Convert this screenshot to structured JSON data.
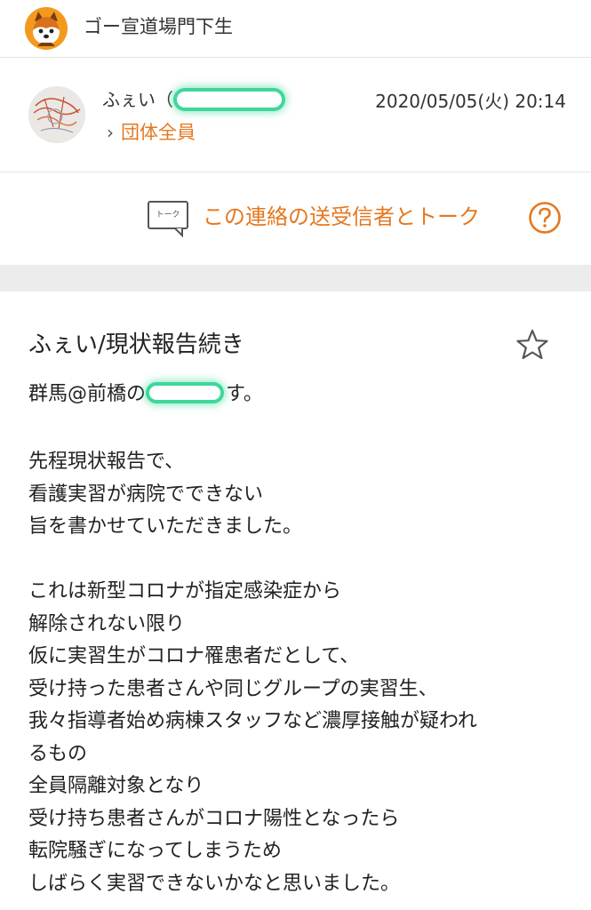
{
  "header": {
    "group_name": "ゴー宣道場門下生",
    "group_avatar_icon": "shiba-dog-icon"
  },
  "message_meta": {
    "sender_name": "ふぇい（",
    "timestamp": "2020/05/05(火) 20:14",
    "recipient_chevron": "›",
    "recipient": "団体全員"
  },
  "talk": {
    "icon_text": "トーク",
    "label": "この連絡の送受信者とトーク"
  },
  "message": {
    "subject": "ふぇい/現状報告続き",
    "greeting_prefix": "群馬@前橋の",
    "greeting_suffix": "す。",
    "paragraph1": [
      "先程現状報告で、",
      "看護実習が病院でできない",
      "旨を書かせていただきました。"
    ],
    "paragraph2": [
      "これは新型コロナが指定感染症から",
      "解除されない限り",
      "仮に実習生がコロナ罹患者だとして、",
      "受け持った患者さんや同じグループの実習生、",
      "我々指導者始め病棟スタッフなど濃厚接触が疑われ",
      "るもの",
      "全員隔離対象となり",
      "受け持ち患者さんがコロナ陽性となったら",
      "転院騒ぎになってしまうため",
      "しばらく実習できないかなと思いました。"
    ]
  },
  "colors": {
    "accent": "#e5781f",
    "divider": "#e4e4e4",
    "band": "#ececec",
    "redaction_marker": "#3fd79a"
  },
  "icons": {
    "talk": "talk-bubble-icon",
    "help": "help-circle-icon",
    "star": "star-outline-icon"
  }
}
